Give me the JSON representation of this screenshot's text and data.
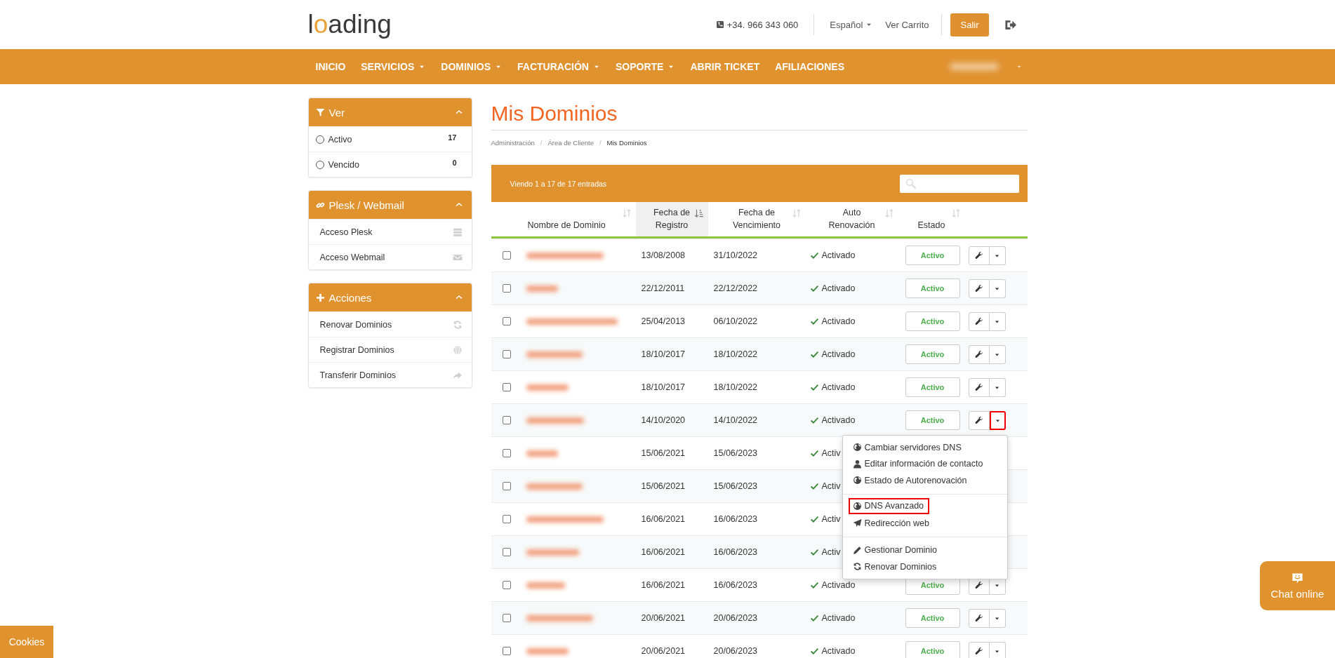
{
  "header": {
    "logo": "loading",
    "phone": "+34. 966 343 060",
    "language": "Español",
    "cart": "Ver Carrito",
    "logout_button": "Salir"
  },
  "nav": {
    "items": [
      {
        "label": "INICIO",
        "dropdown": false
      },
      {
        "label": "SERVICIOS",
        "dropdown": true
      },
      {
        "label": "DOMINIOS",
        "dropdown": true
      },
      {
        "label": "FACTURACIÓN",
        "dropdown": true
      },
      {
        "label": "SOPORTE",
        "dropdown": true
      },
      {
        "label": "ABRIR TICKET",
        "dropdown": false
      },
      {
        "label": "AFILIACIONES",
        "dropdown": false
      }
    ]
  },
  "sidebar": {
    "panels": [
      {
        "title": "Ver",
        "items": [
          {
            "kind": "radio",
            "label": "Activo",
            "count": "17",
            "checked": false
          },
          {
            "kind": "radio",
            "label": "Vencido",
            "count": "0",
            "checked": false
          }
        ]
      },
      {
        "title": "Plesk / Webmail",
        "items": [
          {
            "kind": "link",
            "label": "Acceso Plesk"
          },
          {
            "kind": "link",
            "label": "Acceso Webmail"
          }
        ]
      },
      {
        "title": "Acciones",
        "items": [
          {
            "kind": "link",
            "label": "Renovar Dominios"
          },
          {
            "kind": "link",
            "label": "Registrar Dominios"
          },
          {
            "kind": "link",
            "label": "Transferir Dominios"
          }
        ]
      }
    ]
  },
  "page": {
    "title": "Mis Dominios",
    "breadcrumb": {
      "separator": "/",
      "items": [
        {
          "label": "Administración",
          "current": false
        },
        {
          "label": "Área de Cliente",
          "current": false
        },
        {
          "label": "Mis Dominios",
          "current": true
        }
      ]
    }
  },
  "table": {
    "info": "Viendo 1 a 17 de 17 entradas",
    "columns": [
      {
        "label": "Nombre de Dominio",
        "sorted": false
      },
      {
        "label": "Fecha de\nRegistro",
        "sorted": true
      },
      {
        "label": "Fecha de\nVencimiento",
        "sorted": false
      },
      {
        "label": "Auto\nRenovación",
        "sorted": false
      },
      {
        "label": "Estado",
        "sorted": false
      }
    ],
    "rows": [
      {
        "checked": false,
        "registered": "13/08/2008",
        "expires": "31/10/2022",
        "auto_renewal": "Activado",
        "status": "Activo",
        "menu_open": false
      },
      {
        "checked": false,
        "registered": "22/12/2011",
        "expires": "22/12/2022",
        "auto_renewal": "Activado",
        "status": "Activo",
        "menu_open": false
      },
      {
        "checked": false,
        "registered": "25/04/2013",
        "expires": "06/10/2022",
        "auto_renewal": "Activado",
        "status": "Activo",
        "menu_open": false
      },
      {
        "checked": false,
        "registered": "18/10/2017",
        "expires": "18/10/2022",
        "auto_renewal": "Activado",
        "status": "Activo",
        "menu_open": false
      },
      {
        "checked": false,
        "registered": "18/10/2017",
        "expires": "18/10/2022",
        "auto_renewal": "Activado",
        "status": "Activo",
        "menu_open": false
      },
      {
        "checked": false,
        "registered": "14/10/2020",
        "expires": "14/10/2022",
        "auto_renewal": "Activado",
        "status": "Activo",
        "menu_open": true
      },
      {
        "checked": false,
        "registered": "15/06/2021",
        "expires": "15/06/2023",
        "auto_renewal": "Activ"
      },
      {
        "checked": false,
        "registered": "15/06/2021",
        "expires": "15/06/2023",
        "auto_renewal": "Activ"
      },
      {
        "checked": false,
        "registered": "16/06/2021",
        "expires": "16/06/2023",
        "auto_renewal": "Activ"
      },
      {
        "checked": false,
        "registered": "16/06/2021",
        "expires": "16/06/2023",
        "auto_renewal": "Activ"
      },
      {
        "checked": false,
        "registered": "16/06/2021",
        "expires": "16/06/2023",
        "auto_renewal": "Activado",
        "status": "Activo",
        "menu_open": false
      },
      {
        "checked": false,
        "registered": "20/06/2021",
        "expires": "20/06/2023",
        "auto_renewal": "Activado",
        "status": "Activo",
        "menu_open": false
      },
      {
        "checked": false,
        "registered": "20/06/2021",
        "expires": "20/06/2023",
        "auto_renewal": "Activado",
        "status": "Activo",
        "menu_open": false
      }
    ]
  },
  "row_menu": {
    "groups": [
      [
        {
          "label": "Cambiar servidores DNS",
          "highlighted": false
        },
        {
          "label": "Editar información de contacto",
          "highlighted": false
        },
        {
          "label": "Estado de Autorenovación",
          "highlighted": false
        }
      ],
      [
        {
          "label": "DNS Avanzado",
          "highlighted": true
        },
        {
          "label": "Redirección web",
          "highlighted": false
        }
      ],
      [
        {
          "label": "Gestionar Dominio",
          "highlighted": false
        },
        {
          "label": "Renovar Dominios",
          "highlighted": false
        }
      ]
    ]
  },
  "chat": {
    "label": "Chat online"
  },
  "cookies": {
    "label": "Cookies"
  }
}
